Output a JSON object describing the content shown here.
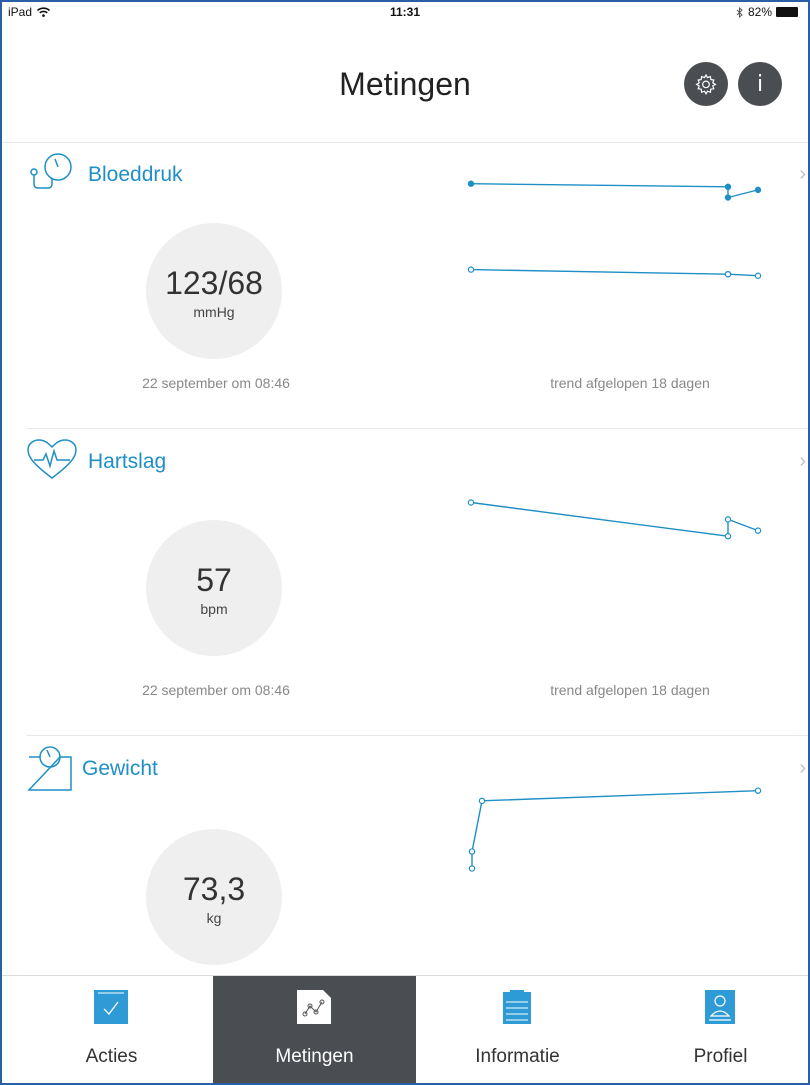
{
  "status_bar": {
    "device": "iPad",
    "time": "11:31",
    "battery": "82%"
  },
  "header": {
    "title": "Metingen"
  },
  "sections": [
    {
      "id": "bloeddruk",
      "title": "Bloeddruk",
      "value": "123/68",
      "unit": "mmHg",
      "date": "22 september om 08:46",
      "trend_label": "trend afgelopen 18 dagen",
      "chart_data": {
        "type": "line",
        "series": [
          {
            "values": [
              128,
              126,
              119,
              124
            ],
            "marker": "filled"
          },
          {
            "values": [
              72,
              69,
              69,
              68
            ],
            "marker": "open"
          }
        ]
      }
    },
    {
      "id": "hartslag",
      "title": "Hartslag",
      "value": "57",
      "unit": "bpm",
      "date": "22 september om 08:46",
      "trend_label": "trend afgelopen 18 dagen",
      "chart_data": {
        "type": "line",
        "series": [
          {
            "values": [
              62,
              56,
              59,
              57
            ],
            "marker": "open"
          }
        ]
      }
    },
    {
      "id": "gewicht",
      "title": "Gewicht",
      "value": "73,3",
      "unit": "kg",
      "chart_data": {
        "type": "line",
        "series": [
          {
            "values": [
              71.0,
              71.5,
              73.0,
              73.3
            ],
            "marker": "open"
          }
        ]
      }
    }
  ],
  "tabs": [
    {
      "label": "Acties",
      "icon": "checkbox-icon"
    },
    {
      "label": "Metingen",
      "icon": "chart-document-icon",
      "active": true
    },
    {
      "label": "Informatie",
      "icon": "clipboard-icon"
    },
    {
      "label": "Profiel",
      "icon": "profile-icon"
    }
  ],
  "colors": {
    "accent": "#1f8fc6",
    "tab_active_bg": "#4a4d52"
  }
}
